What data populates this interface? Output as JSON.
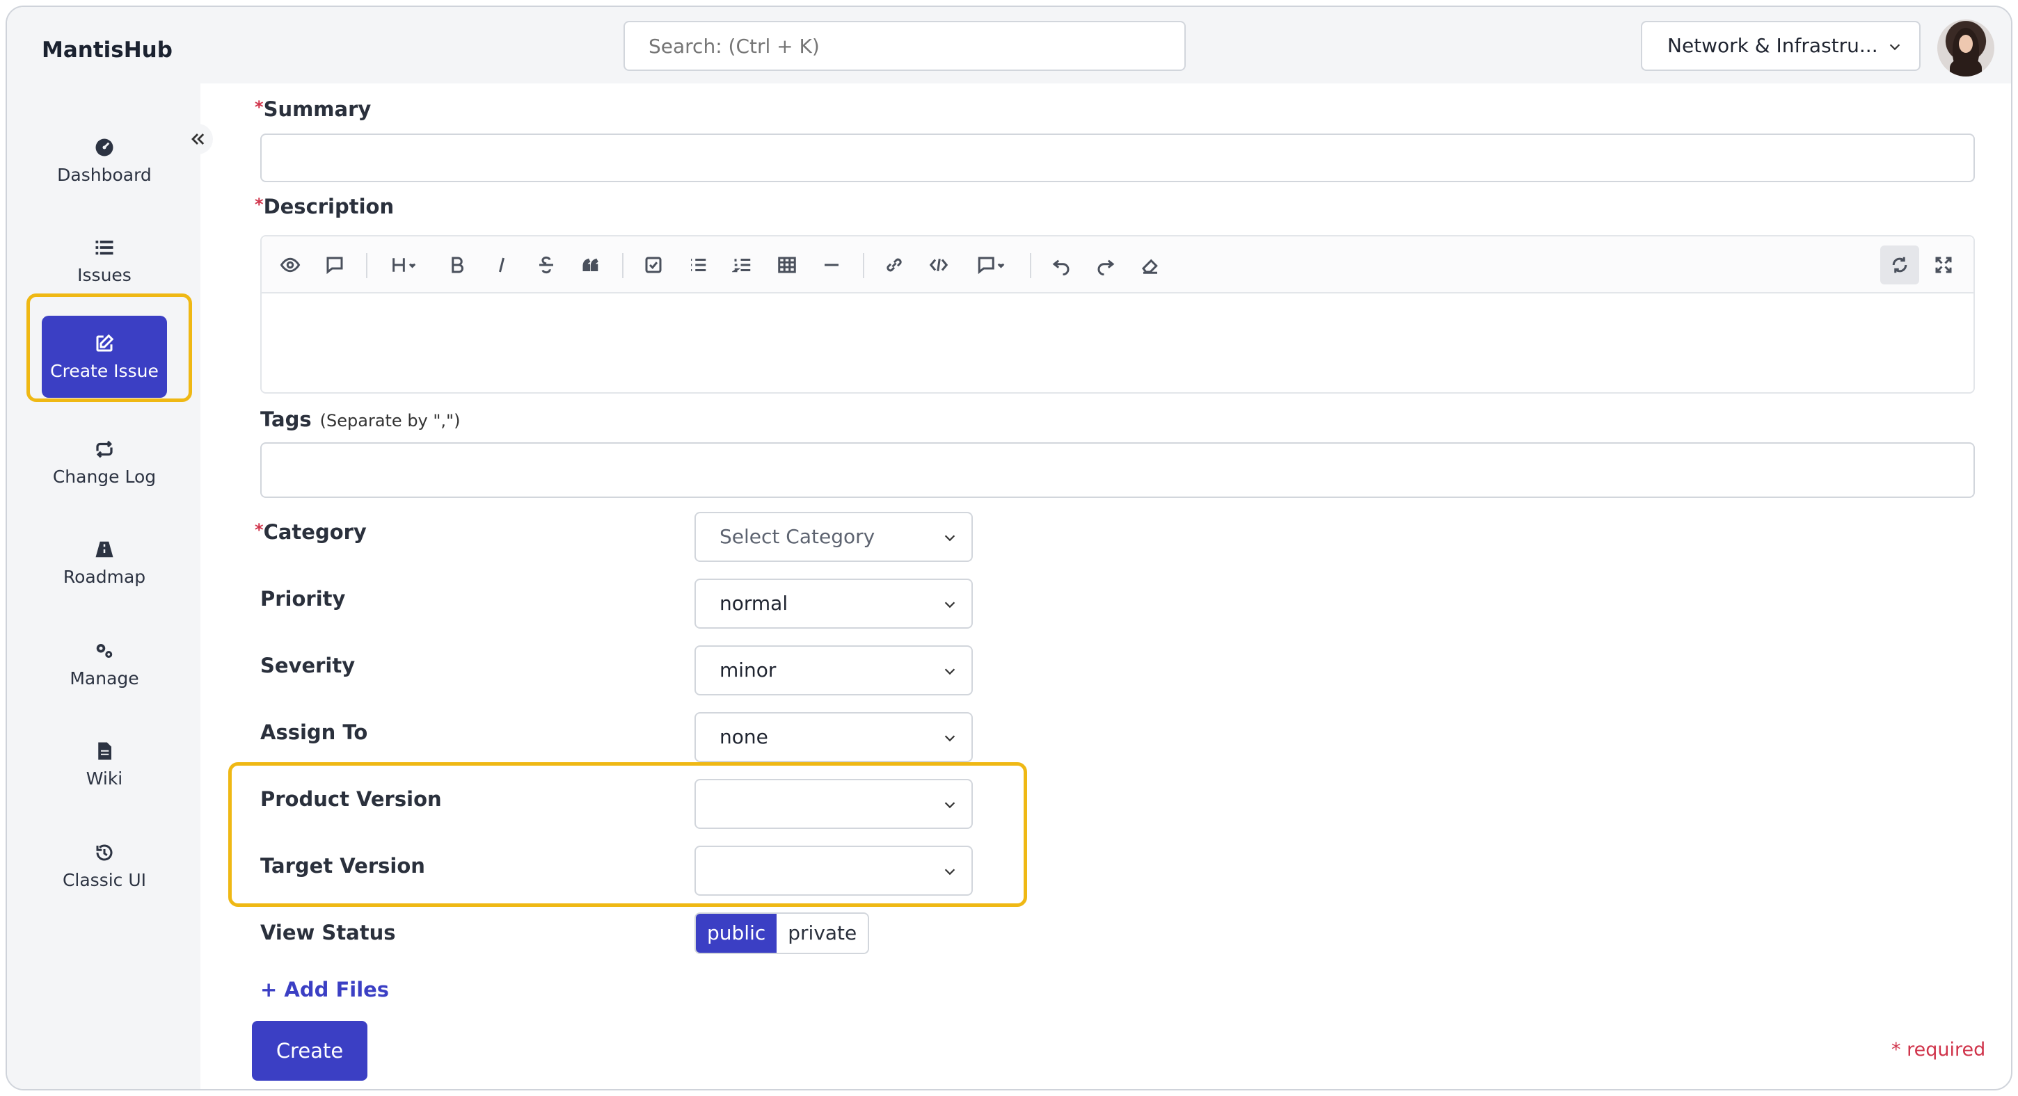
{
  "app": {
    "brand": "MantisHub"
  },
  "header": {
    "search_placeholder": "Search: (Ctrl + K)",
    "project": "Network & Infrastru..."
  },
  "sidebar": {
    "items": [
      {
        "label": "Dashboard",
        "icon": "dashboard-icon"
      },
      {
        "label": "Issues",
        "icon": "list-icon"
      },
      {
        "label": "Create Issue",
        "icon": "edit-icon",
        "active": true
      },
      {
        "label": "Change Log",
        "icon": "repeat-icon"
      },
      {
        "label": "Roadmap",
        "icon": "road-icon"
      },
      {
        "label": "Manage",
        "icon": "gears-icon"
      },
      {
        "label": "Wiki",
        "icon": "file-icon"
      },
      {
        "label": "Classic UI",
        "icon": "history-icon"
      }
    ]
  },
  "form": {
    "summary_label": "Summary",
    "description_label": "Description",
    "tags_label": "Tags",
    "tags_hint": "(Separate by \",\")",
    "required_mark": "*",
    "category_label": "Category",
    "category_value": "Select Category",
    "priority_label": "Priority",
    "priority_value": "normal",
    "severity_label": "Severity",
    "severity_value": "minor",
    "assign_label": "Assign To",
    "assign_value": "none",
    "product_version_label": "Product Version",
    "product_version_value": "",
    "target_version_label": "Target Version",
    "target_version_value": "",
    "view_status_label": "View Status",
    "view_status_options": [
      "public",
      "private"
    ],
    "view_status_selected": "public",
    "add_files": "+ Add Files",
    "create_button": "Create",
    "required_note": "* required"
  },
  "colors": {
    "accent": "#3b3fc4",
    "highlight": "#efb814",
    "required": "#d0344b"
  }
}
